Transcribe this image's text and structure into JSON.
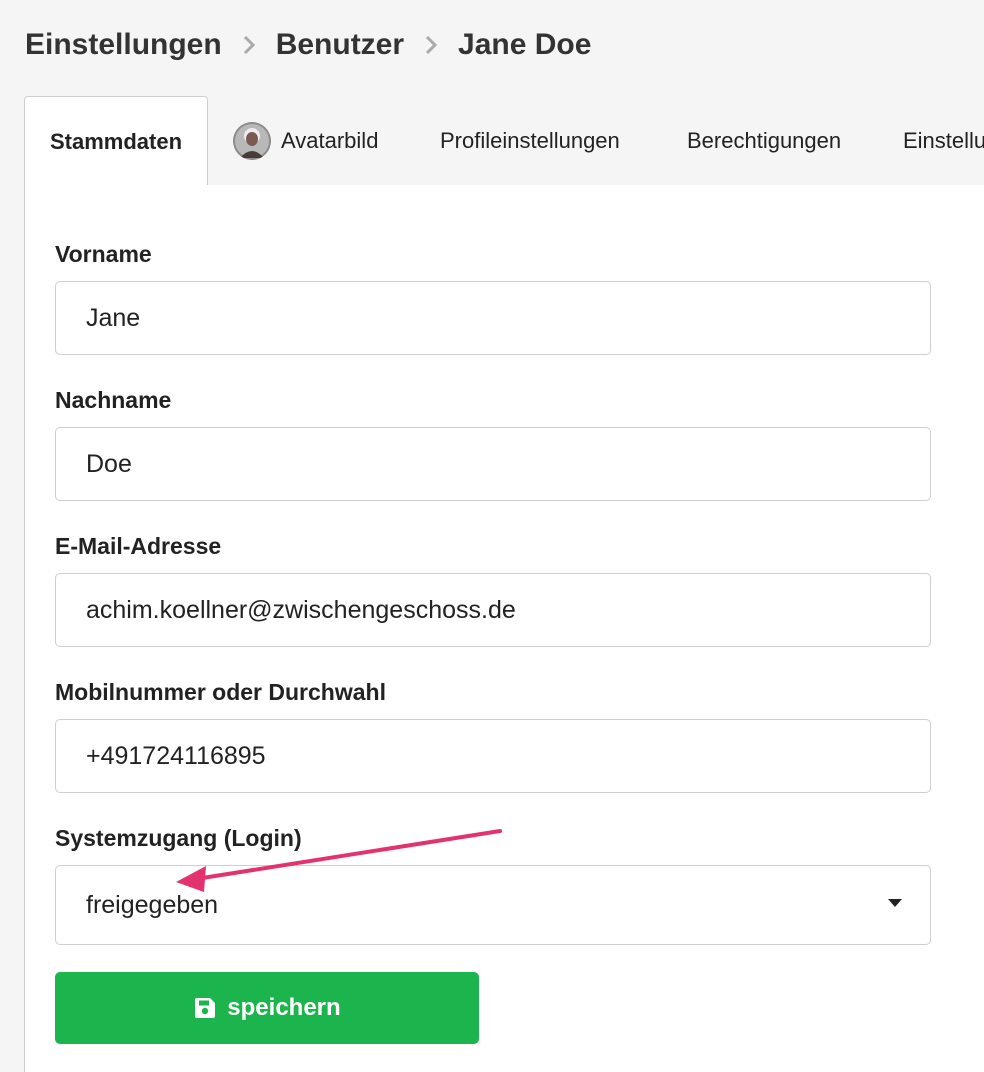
{
  "breadcrumb": {
    "items": [
      "Einstellungen",
      "Benutzer",
      "Jane Doe"
    ]
  },
  "tabs": [
    {
      "label": "Stammdaten",
      "active": true
    },
    {
      "label": "Avatarbild",
      "icon": "avatar"
    },
    {
      "label": "Profileinstellungen"
    },
    {
      "label": "Berechtigungen"
    },
    {
      "label": "Einstellu"
    }
  ],
  "form": {
    "first_name": {
      "label": "Vorname",
      "value": "Jane"
    },
    "last_name": {
      "label": "Nachname",
      "value": "Doe"
    },
    "email": {
      "label": "E-Mail-Adresse",
      "value": "achim.koellner@zwischengeschoss.de"
    },
    "phone": {
      "label": "Mobilnummer oder Durchwahl",
      "value": "+491724116895"
    },
    "login": {
      "label": "Systemzugang (Login)",
      "value": "freigegeben"
    }
  },
  "save_button": {
    "label": "speichern",
    "icon": "floppy-disk-icon"
  },
  "colors": {
    "primary_button": "#1cb44c",
    "annotation_arrow": "#e2336f"
  }
}
